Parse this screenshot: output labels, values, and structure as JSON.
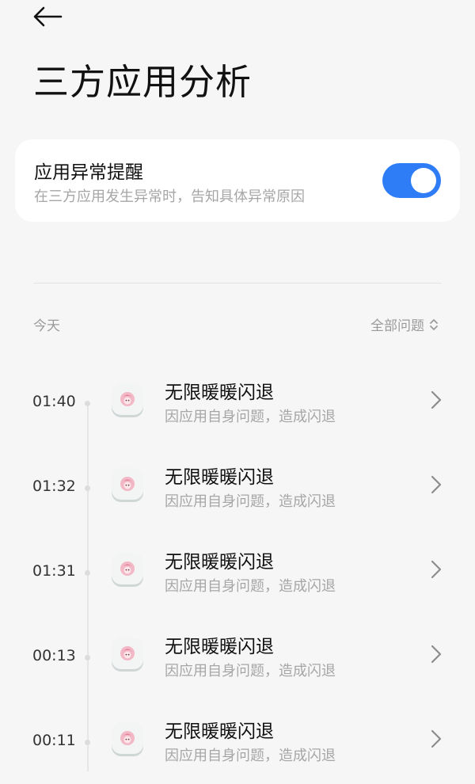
{
  "header": {
    "title": "三方应用分析"
  },
  "alert_setting": {
    "title": "应用异常提醒",
    "subtitle": "在三方应用发生异常时，告知具体异常原因",
    "enabled": true
  },
  "list": {
    "section_label": "今天",
    "filter_label": "全部问题",
    "items": [
      {
        "time": "01:40",
        "app": "无限暖暖闪退",
        "reason": "因应用自身问题，造成闪退"
      },
      {
        "time": "01:32",
        "app": "无限暖暖闪退",
        "reason": "因应用自身问题，造成闪退"
      },
      {
        "time": "01:31",
        "app": "无限暖暖闪退",
        "reason": "因应用自身问题，造成闪退"
      },
      {
        "time": "00:13",
        "app": "无限暖暖闪退",
        "reason": "因应用自身问题，造成闪退"
      },
      {
        "time": "00:11",
        "app": "无限暖暖闪退",
        "reason": "因应用自身问题，造成闪退"
      }
    ]
  },
  "colors": {
    "accent": "#2f7df6",
    "background": "#f6f6f6"
  }
}
